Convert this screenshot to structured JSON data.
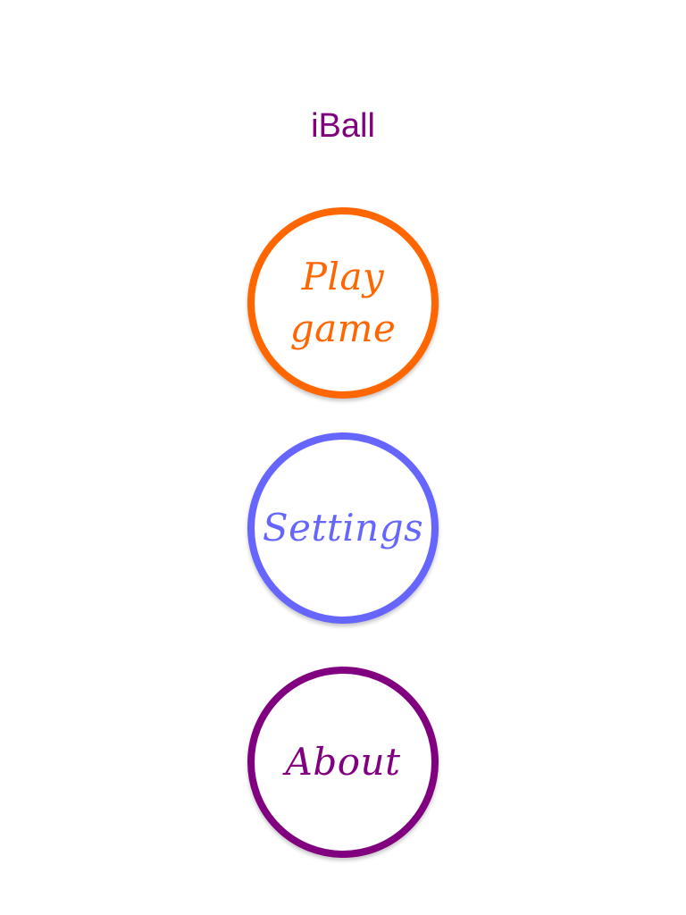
{
  "app": {
    "title": "iBall"
  },
  "menu": {
    "buttons": [
      {
        "label": "Play\ngame",
        "color": "#FF6600"
      },
      {
        "label": "Settings",
        "color": "#6666FF"
      },
      {
        "label": "About",
        "color": "#800080"
      }
    ]
  },
  "colors": {
    "background": "#FFFFFF",
    "title": "#800080",
    "shadow": "rgba(0,0,0,0.22)"
  }
}
